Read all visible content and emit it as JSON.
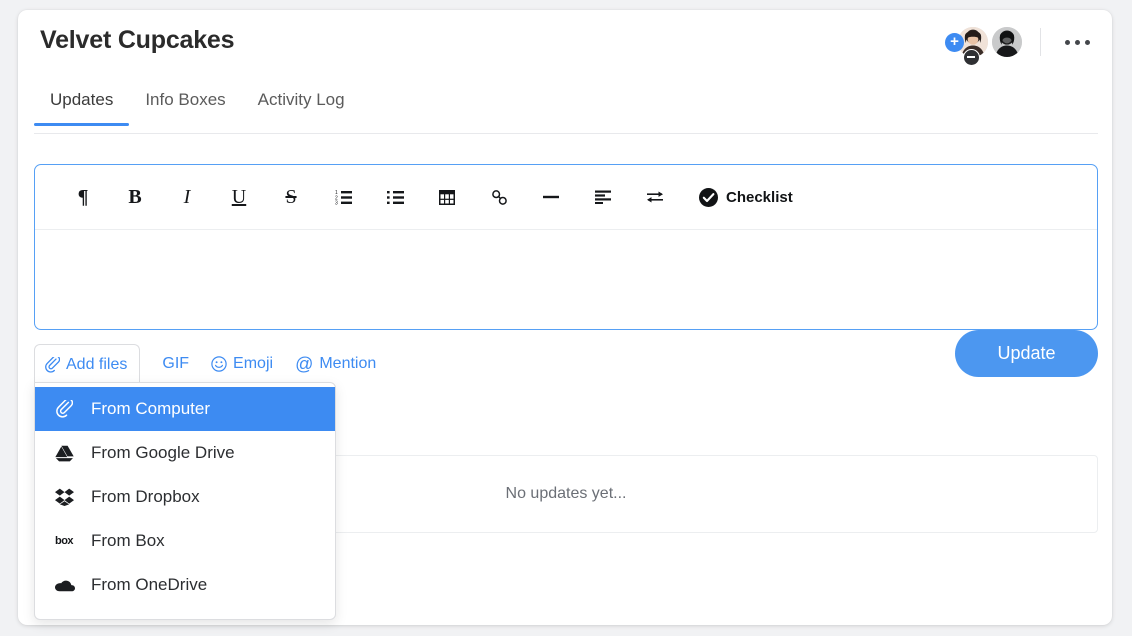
{
  "header": {
    "title": "Velvet Cupcakes",
    "tabs": [
      {
        "label": "Updates",
        "active": true
      },
      {
        "label": "Info Boxes",
        "active": false
      },
      {
        "label": "Activity Log",
        "active": false
      }
    ],
    "add_member_badge": "+",
    "kebab_menu_label": "More options"
  },
  "editor": {
    "toolbar": [
      {
        "name": "paragraph",
        "glyph": "¶"
      },
      {
        "name": "bold",
        "glyph": "B"
      },
      {
        "name": "italic",
        "glyph": "I"
      },
      {
        "name": "underline",
        "glyph": "U"
      },
      {
        "name": "strikethrough",
        "glyph": "S"
      },
      {
        "name": "ordered-list",
        "glyph": ""
      },
      {
        "name": "bulleted-list",
        "glyph": ""
      },
      {
        "name": "table",
        "glyph": ""
      },
      {
        "name": "link",
        "glyph": ""
      },
      {
        "name": "horizontal-rule",
        "glyph": ""
      },
      {
        "name": "align-left",
        "glyph": ""
      },
      {
        "name": "swap",
        "glyph": ""
      }
    ],
    "checklist_label": "Checklist",
    "body_placeholder": ""
  },
  "attachments": {
    "add_files_label": "Add files",
    "gif_label": "GIF",
    "emoji_label": "Emoji",
    "mention_label": "Mention",
    "mention_symbol": "@",
    "update_button": "Update"
  },
  "dropdown": {
    "items": [
      {
        "label": "From Computer",
        "icon": "paperclip-icon",
        "selected": true
      },
      {
        "label": "From Google Drive",
        "icon": "google-drive-icon",
        "selected": false
      },
      {
        "label": "From Dropbox",
        "icon": "dropbox-icon",
        "selected": false
      },
      {
        "label": "From Box",
        "icon": "box-icon",
        "selected": false
      },
      {
        "label": "From OneDrive",
        "icon": "onedrive-icon",
        "selected": false
      }
    ],
    "box_wordmark": "box"
  },
  "updates": {
    "empty_text": "No updates yet..."
  },
  "colors": {
    "accent": "#3d8bf2",
    "button": "#4c97f0",
    "text": "#2c2e31",
    "muted": "#6b6f76"
  }
}
